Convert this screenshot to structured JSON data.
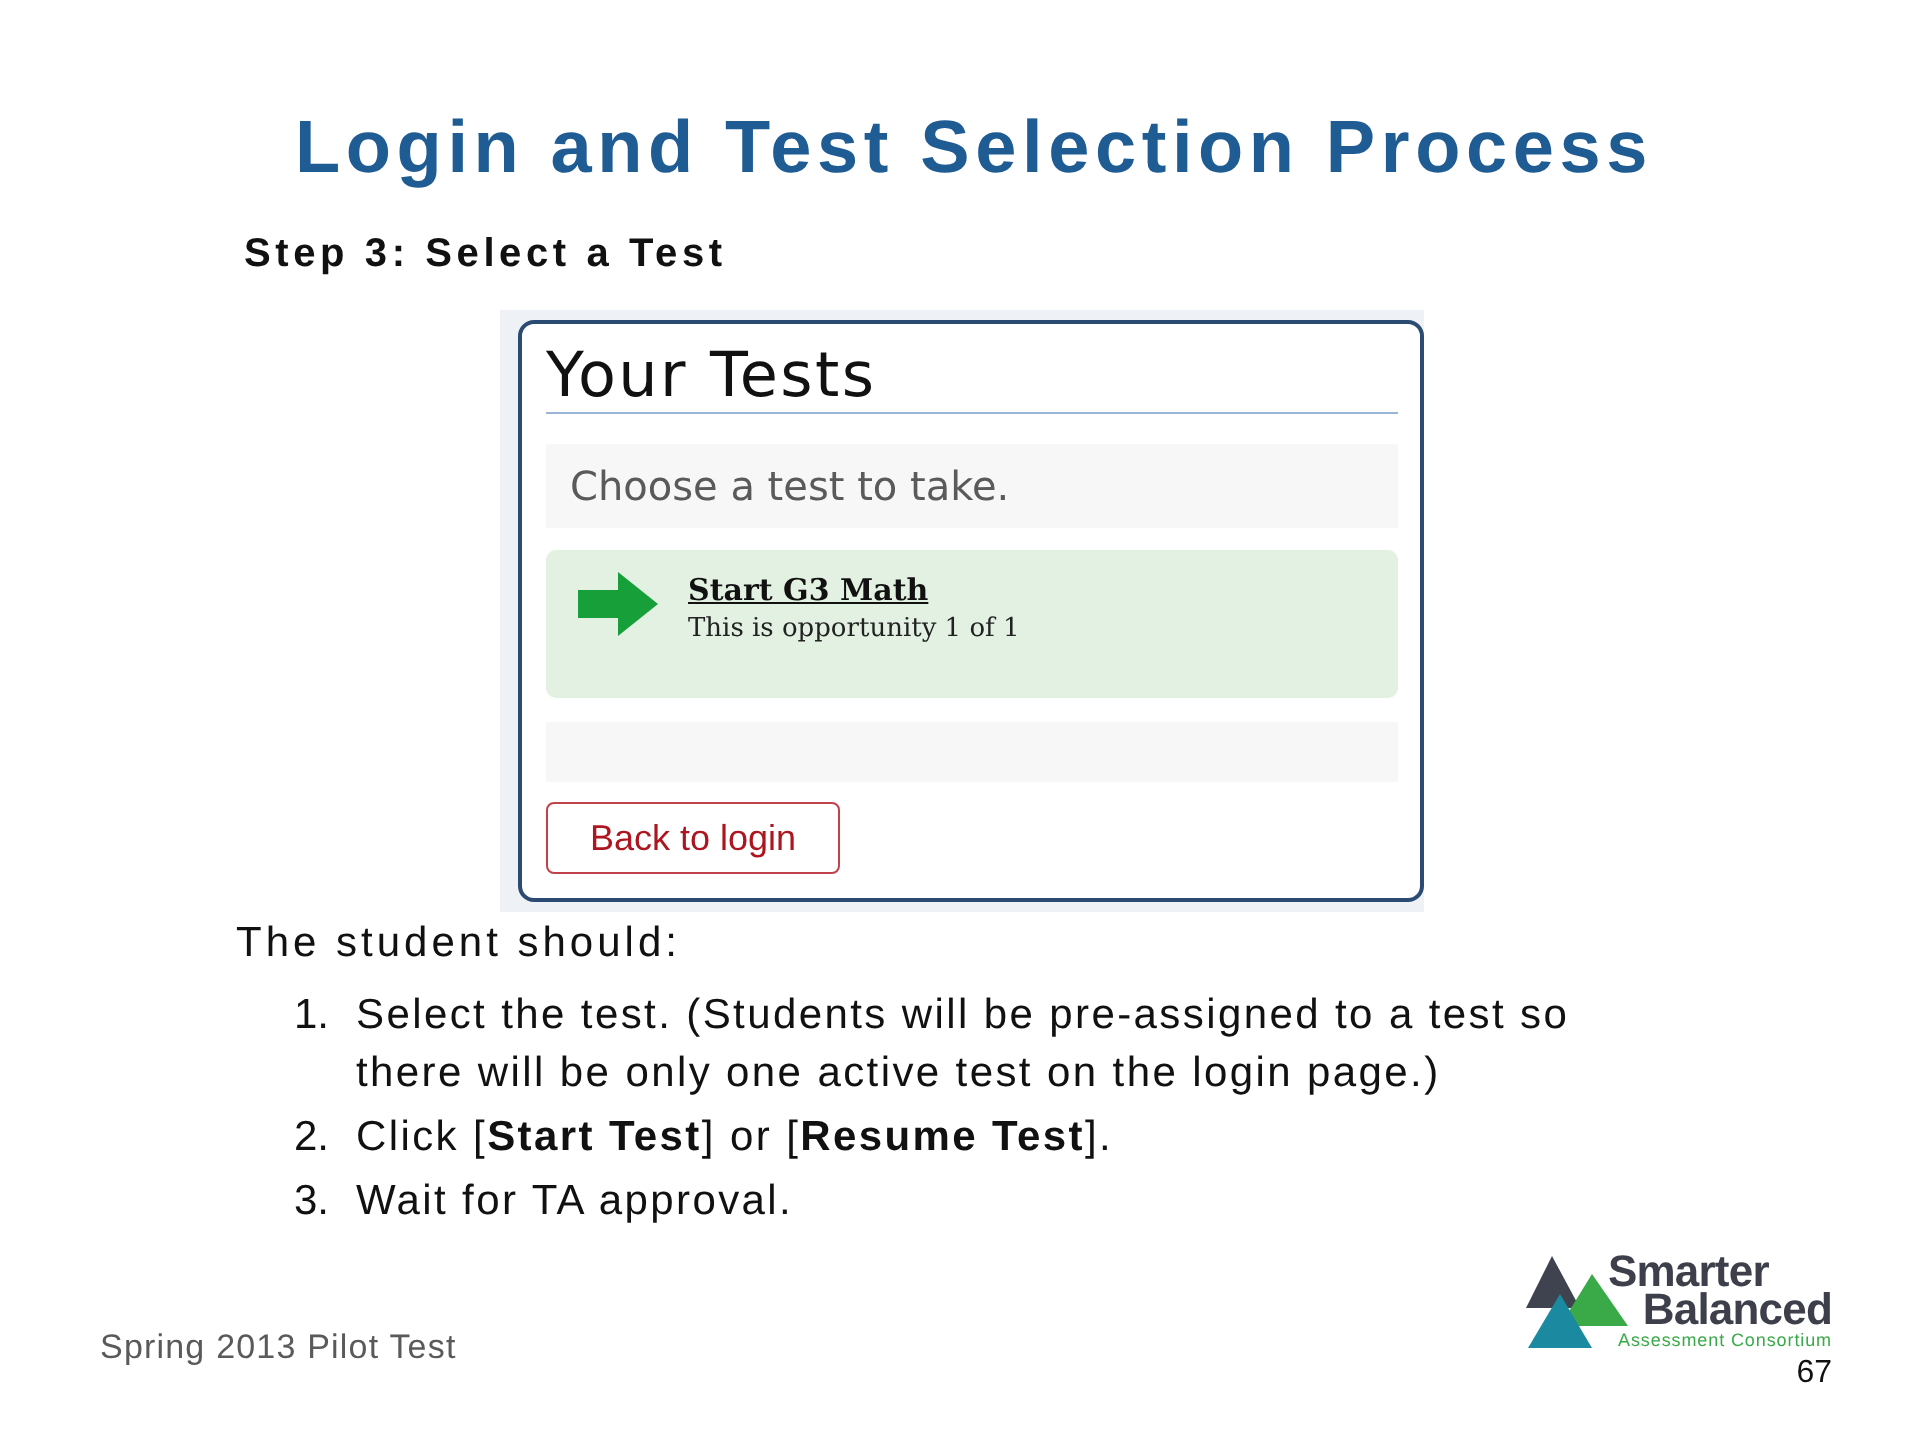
{
  "slide": {
    "title": "Login and Test Selection Process",
    "subtitle": "Step 3: Select a Test"
  },
  "screenshot": {
    "heading": "Your Tests",
    "prompt": "Choose a test to take.",
    "tests": [
      {
        "name": "Start G3 Math",
        "note": "This is opportunity 1 of 1"
      }
    ],
    "back_button": "Back to login"
  },
  "instructions": {
    "lead": "The student should:",
    "steps": [
      {
        "number": "1.",
        "text": "Select the test. (Students will be pre-assigned to a test so there will be only one active test on the login page.)"
      },
      {
        "number": "2.",
        "text": "Click [**Start Test**] or [**Resume Test**]."
      },
      {
        "number": "3.",
        "text": "Wait for TA approval."
      }
    ]
  },
  "footer": {
    "text": "Spring 2013 Pilot Test",
    "logo": {
      "line_1": "Smarter",
      "line_2": "Balanced",
      "tagline": "Assessment Consortium"
    },
    "page_number": "67"
  }
}
